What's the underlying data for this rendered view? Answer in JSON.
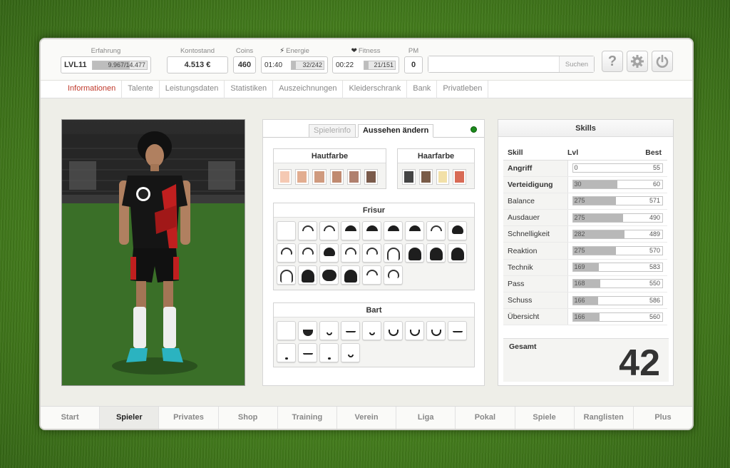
{
  "stats": {
    "erfahrung": {
      "label": "Erfahrung",
      "level": "LVL11",
      "progress": "9.967/14.477",
      "fraction": 0.69
    },
    "kontostand": {
      "label": "Kontostand",
      "value": "4.513 €"
    },
    "coins": {
      "label": "Coins",
      "value": "460"
    },
    "energie": {
      "label": "Energie",
      "time": "01:40",
      "progress": "32/242",
      "fraction": 0.13
    },
    "fitness": {
      "label": "Fitness",
      "time": "00:22",
      "progress": "21/151",
      "fraction": 0.14
    },
    "pm": {
      "label": "PM",
      "value": "0"
    }
  },
  "search": {
    "placeholder": "",
    "button": "Suchen"
  },
  "toolbar": {
    "help": "?",
    "settings_icon": "gear-icon",
    "power_icon": "power-icon"
  },
  "subnav": [
    "Informationen",
    "Talente",
    "Leistungsdaten",
    "Statistiken",
    "Auszeichnungen",
    "Kleiderschrank",
    "Bank",
    "Privatleben"
  ],
  "tabs": {
    "spielerinfo": "Spielerinfo",
    "aussehen": "Aussehen ändern"
  },
  "hautfarbe": {
    "title": "Hautfarbe",
    "colors": [
      "#f5c9b3",
      "#e2ad90",
      "#cf9a7e",
      "#c08a70",
      "#b0806e",
      "#7a5a4a"
    ]
  },
  "haarfarbe": {
    "title": "Haarfarbe",
    "colors": [
      "#444444",
      "#7a5c48",
      "#f2e0a8",
      "#d86a55"
    ]
  },
  "frisur": {
    "title": "Frisur"
  },
  "bart": {
    "title": "Bart"
  },
  "skills": {
    "title": "Skills",
    "headers": {
      "skill": "Skill",
      "lvl": "Lvl",
      "best": "Best"
    },
    "rows": [
      {
        "name": "Angriff",
        "lvl": "0",
        "best": "55",
        "fraction": 0.0,
        "bold": true
      },
      {
        "name": "Verteidigung",
        "lvl": "30",
        "best": "60",
        "fraction": 0.5,
        "bold": true
      },
      {
        "name": "Balance",
        "lvl": "275",
        "best": "571",
        "fraction": 0.48
      },
      {
        "name": "Ausdauer",
        "lvl": "275",
        "best": "490",
        "fraction": 0.56
      },
      {
        "name": "Schnelligkeit",
        "lvl": "282",
        "best": "489",
        "fraction": 0.58
      },
      {
        "name": "Reaktion",
        "lvl": "275",
        "best": "570",
        "fraction": 0.48
      },
      {
        "name": "Technik",
        "lvl": "169",
        "best": "583",
        "fraction": 0.29
      },
      {
        "name": "Pass",
        "lvl": "168",
        "best": "550",
        "fraction": 0.31
      },
      {
        "name": "Schuss",
        "lvl": "166",
        "best": "586",
        "fraction": 0.28
      },
      {
        "name": "Übersicht",
        "lvl": "166",
        "best": "560",
        "fraction": 0.3
      }
    ],
    "gesamt_label": "Gesamt",
    "gesamt_value": "42"
  },
  "bottomnav": [
    "Start",
    "Spieler",
    "Privates",
    "Shop",
    "Training",
    "Verein",
    "Liga",
    "Pokal",
    "Spiele",
    "Ranglisten",
    "Plus"
  ],
  "bottomnav_active": 1
}
